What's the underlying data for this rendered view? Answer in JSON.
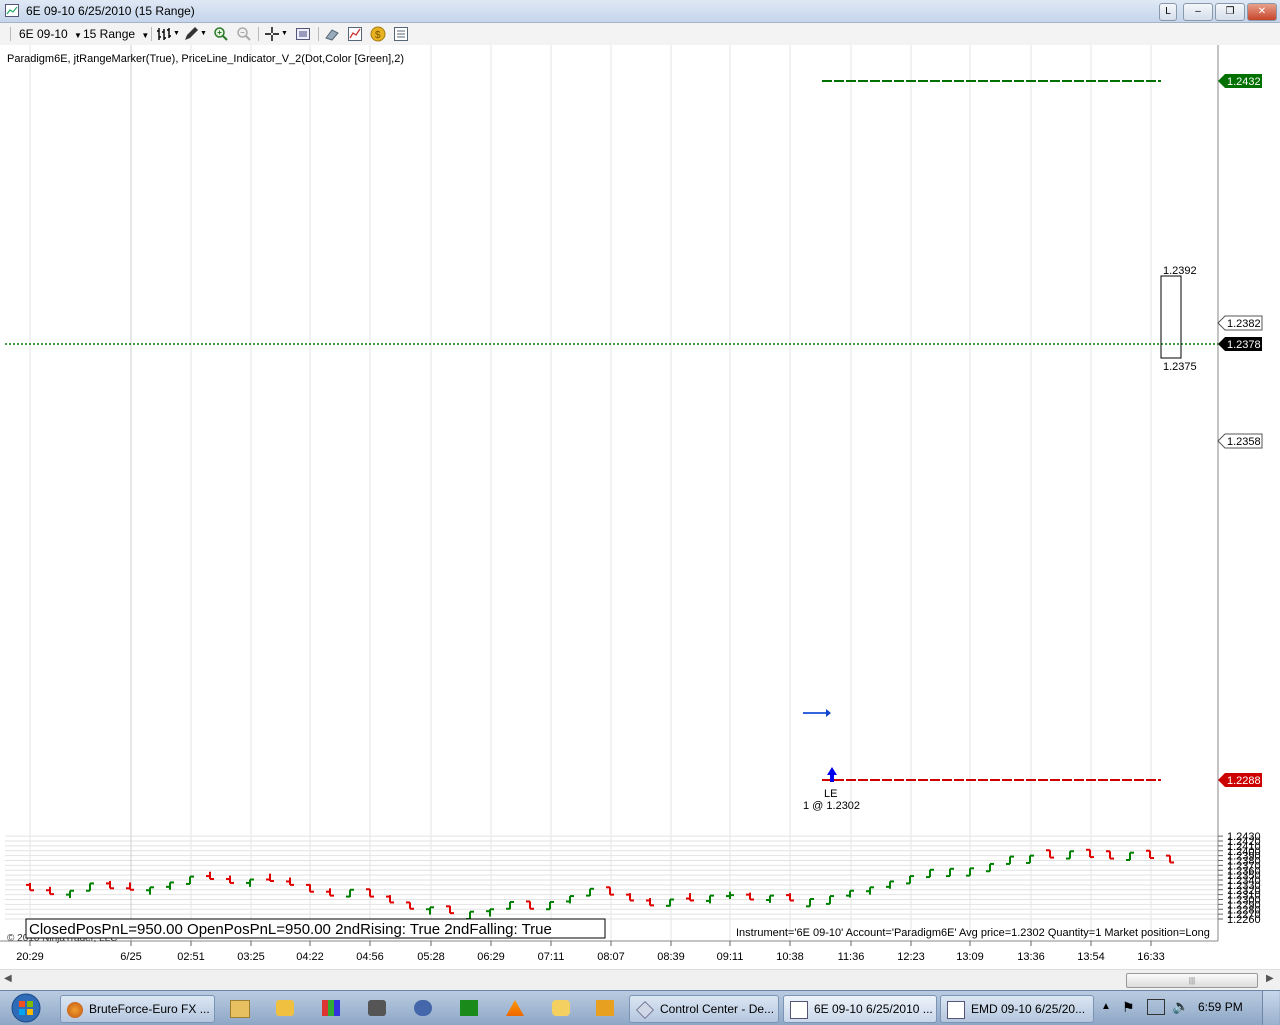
{
  "window": {
    "title": "6E 09-10  6/25/2010 (15 Range)",
    "buttons": [
      "L",
      "–",
      "❐",
      "✕"
    ]
  },
  "toolbar": {
    "instrument": "6E 09-10",
    "period": "15 Range",
    "icons": [
      "bar-style-icon",
      "drawing-pencil-icon",
      "zoom-in-icon",
      "zoom-out-icon",
      "crosshair-icon",
      "data-box-icon",
      "properties-icon",
      "strategy-icon",
      "gold-coin-icon",
      "chart-list-icon"
    ]
  },
  "chart_header": "Paradigm6E, jtRangeMarker(True), PriceLine_Indicator_V_2(Dot,Color [Green],2)",
  "copyright": "© 2010 NinjaTrader, LLC",
  "status_box": "ClosedPosPnL=950.00 OpenPosPnL=950.00 2ndRising: True 2ndFalling: True",
  "position_info": "Instrument='6E 09-10' Account='Paradigm6E' Avg price=1.2302 Quantity=1 Market position=Long",
  "entry_marker": {
    "label": "LE",
    "fill": "1 @ 1.2302"
  },
  "range_marker": {
    "high_label": "1.2392",
    "low_label": "1.2375"
  },
  "price_flags": {
    "target": "1.2432",
    "stop": "1.2288",
    "last": "1.2378",
    "gray1": "1.2382",
    "gray2": "1.2358"
  },
  "colors": {
    "up": "#008000",
    "down": "#e00000",
    "target": "#007000",
    "stop": "#cc0000",
    "last": "#000000"
  },
  "chart_data": {
    "type": "ohlc-bar",
    "y_ticks": [
      "1.2430",
      "1.2420",
      "1.2410",
      "1.2400",
      "1.2390",
      "1.2380",
      "1.2370",
      "1.2360",
      "1.2350",
      "1.2340",
      "1.2330",
      "1.2320",
      "1.2310",
      "1.2300",
      "1.2290",
      "1.2280",
      "1.2270",
      "1.2260"
    ],
    "x_ticks": [
      "20:29",
      "6/25",
      "02:51",
      "03:25",
      "04:22",
      "04:56",
      "05:28",
      "06:29",
      "07:11",
      "08:07",
      "08:39",
      "09:11",
      "10:38",
      "11:36",
      "12:23",
      "13:09",
      "13:36",
      "13:54",
      "16:33"
    ],
    "ylim": [
      1.2256,
      1.244
    ],
    "grid": true,
    "bars": [
      {
        "o": 1.233,
        "h": 1.2334,
        "l": 1.2319,
        "c": 1.2319
      },
      {
        "o": 1.2319,
        "h": 1.2326,
        "l": 1.2311,
        "c": 1.2311
      },
      {
        "o": 1.231,
        "h": 1.2318,
        "l": 1.2303,
        "c": 1.2318
      },
      {
        "o": 1.2318,
        "h": 1.2333,
        "l": 1.2318,
        "c": 1.2333
      },
      {
        "o": 1.2333,
        "h": 1.2338,
        "l": 1.2323,
        "c": 1.2323
      },
      {
        "o": 1.2323,
        "h": 1.2335,
        "l": 1.232,
        "c": 1.232
      },
      {
        "o": 1.2319,
        "h": 1.2325,
        "l": 1.231,
        "c": 1.2325
      },
      {
        "o": 1.2326,
        "h": 1.2335,
        "l": 1.232,
        "c": 1.2335
      },
      {
        "o": 1.2332,
        "h": 1.2347,
        "l": 1.2332,
        "c": 1.2347
      },
      {
        "o": 1.2348,
        "h": 1.2357,
        "l": 1.2342,
        "c": 1.2342
      },
      {
        "o": 1.2342,
        "h": 1.2349,
        "l": 1.2334,
        "c": 1.2334
      },
      {
        "o": 1.2334,
        "h": 1.2341,
        "l": 1.2326,
        "c": 1.2341
      },
      {
        "o": 1.2341,
        "h": 1.2353,
        "l": 1.2338,
        "c": 1.2338
      },
      {
        "o": 1.2337,
        "h": 1.2345,
        "l": 1.233,
        "c": 1.233
      },
      {
        "o": 1.233,
        "h": 1.2331,
        "l": 1.2316,
        "c": 1.2316
      },
      {
        "o": 1.2316,
        "h": 1.2323,
        "l": 1.2308,
        "c": 1.2308
      },
      {
        "o": 1.2306,
        "h": 1.232,
        "l": 1.2305,
        "c": 1.232
      },
      {
        "o": 1.2321,
        "h": 1.2321,
        "l": 1.2306,
        "c": 1.2306
      },
      {
        "o": 1.2306,
        "h": 1.2309,
        "l": 1.2294,
        "c": 1.2294
      },
      {
        "o": 1.2294,
        "h": 1.2294,
        "l": 1.2281,
        "c": 1.2281
      },
      {
        "o": 1.228,
        "h": 1.2284,
        "l": 1.2269,
        "c": 1.2284
      },
      {
        "o": 1.2286,
        "h": 1.2287,
        "l": 1.2272,
        "c": 1.2272
      },
      {
        "o": 1.226,
        "h": 1.2275,
        "l": 1.2257,
        "c": 1.2275
      },
      {
        "o": 1.2276,
        "h": 1.228,
        "l": 1.2265,
        "c": 1.228
      },
      {
        "o": 1.2281,
        "h": 1.2295,
        "l": 1.228,
        "c": 1.2295
      },
      {
        "o": 1.2296,
        "h": 1.2296,
        "l": 1.2281,
        "c": 1.2281
      },
      {
        "o": 1.228,
        "h": 1.2295,
        "l": 1.228,
        "c": 1.2295
      },
      {
        "o": 1.2296,
        "h": 1.2307,
        "l": 1.2292,
        "c": 1.2307
      },
      {
        "o": 1.2308,
        "h": 1.2322,
        "l": 1.2307,
        "c": 1.2322
      },
      {
        "o": 1.2325,
        "h": 1.2325,
        "l": 1.231,
        "c": 1.231
      },
      {
        "o": 1.231,
        "h": 1.2313,
        "l": 1.2298,
        "c": 1.2298
      },
      {
        "o": 1.2298,
        "h": 1.2303,
        "l": 1.2288,
        "c": 1.2288
      },
      {
        "o": 1.2287,
        "h": 1.23,
        "l": 1.2286,
        "c": 1.23
      },
      {
        "o": 1.2302,
        "h": 1.2313,
        "l": 1.2298,
        "c": 1.2298
      },
      {
        "o": 1.2297,
        "h": 1.2308,
        "l": 1.2292,
        "c": 1.2308
      },
      {
        "o": 1.2307,
        "h": 1.2316,
        "l": 1.2301,
        "c": 1.2309
      },
      {
        "o": 1.231,
        "h": 1.2314,
        "l": 1.23,
        "c": 1.23
      },
      {
        "o": 1.2299,
        "h": 1.2308,
        "l": 1.2293,
        "c": 1.2308
      },
      {
        "o": 1.2309,
        "h": 1.2313,
        "l": 1.2298,
        "c": 1.2298
      },
      {
        "o": 1.2286,
        "h": 1.2301,
        "l": 1.2286,
        "c": 1.2301
      },
      {
        "o": 1.2291,
        "h": 1.2307,
        "l": 1.2291,
        "c": 1.2307
      },
      {
        "o": 1.2308,
        "h": 1.2318,
        "l": 1.2304,
        "c": 1.2318
      },
      {
        "o": 1.2317,
        "h": 1.2325,
        "l": 1.231,
        "c": 1.2325
      },
      {
        "o": 1.2326,
        "h": 1.2337,
        "l": 1.2322,
        "c": 1.2337
      },
      {
        "o": 1.2333,
        "h": 1.2348,
        "l": 1.2333,
        "c": 1.2348
      },
      {
        "o": 1.2346,
        "h": 1.2361,
        "l": 1.2346,
        "c": 1.2361
      },
      {
        "o": 1.2348,
        "h": 1.2363,
        "l": 1.2348,
        "c": 1.2363
      },
      {
        "o": 1.2349,
        "h": 1.2364,
        "l": 1.2349,
        "c": 1.2364
      },
      {
        "o": 1.2358,
        "h": 1.2373,
        "l": 1.2358,
        "c": 1.2373
      },
      {
        "o": 1.2373,
        "h": 1.2388,
        "l": 1.2373,
        "c": 1.2388
      },
      {
        "o": 1.2375,
        "h": 1.239,
        "l": 1.2375,
        "c": 1.239
      },
      {
        "o": 1.2401,
        "h": 1.2401,
        "l": 1.2386,
        "c": 1.2386
      },
      {
        "o": 1.2384,
        "h": 1.2399,
        "l": 1.2384,
        "c": 1.2399
      },
      {
        "o": 1.2402,
        "h": 1.2402,
        "l": 1.2387,
        "c": 1.2387
      },
      {
        "o": 1.2399,
        "h": 1.2399,
        "l": 1.2384,
        "c": 1.2384
      },
      {
        "o": 1.2381,
        "h": 1.2396,
        "l": 1.2381,
        "c": 1.2396
      },
      {
        "o": 1.24,
        "h": 1.24,
        "l": 1.2385,
        "c": 1.2385
      },
      {
        "o": 1.239,
        "h": 1.239,
        "l": 1.2376,
        "c": 1.2376
      }
    ]
  },
  "taskbar": {
    "tasks": [
      "BruteForce-Euro FX ...",
      "Control Center - De...",
      "6E 09-10  6/25/2010 ...",
      "EMD 09-10  6/25/20..."
    ],
    "clock": "6:59 PM"
  }
}
